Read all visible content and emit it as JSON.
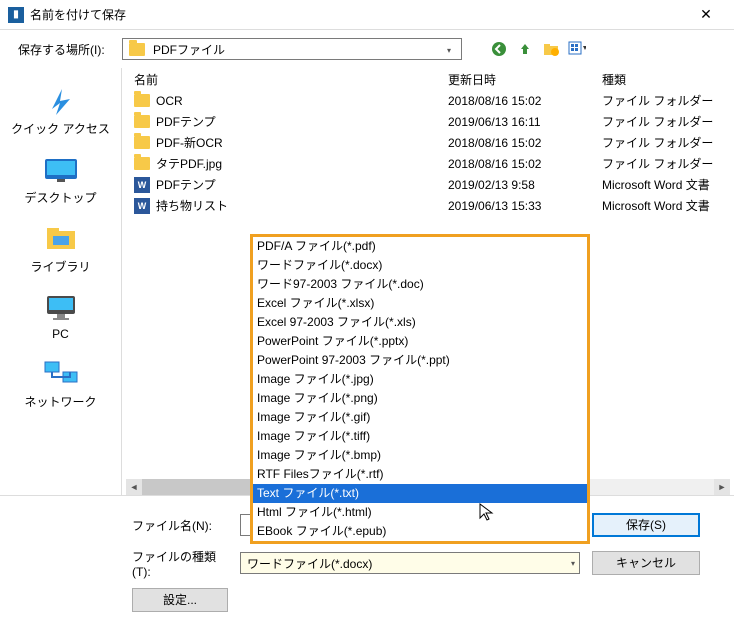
{
  "title": "名前を付けて保存",
  "locationLabel": "保存する場所(I):",
  "locationValue": "PDFファイル",
  "columns": {
    "name": "名前",
    "date": "更新日時",
    "type": "種類"
  },
  "places": [
    {
      "key": "quick",
      "label": "クイック アクセス"
    },
    {
      "key": "desktop",
      "label": "デスクトップ"
    },
    {
      "key": "library",
      "label": "ライブラリ"
    },
    {
      "key": "pc",
      "label": "PC"
    },
    {
      "key": "network",
      "label": "ネットワーク"
    }
  ],
  "files": [
    {
      "icon": "folder",
      "name": "OCR",
      "date": "2018/08/16 15:02",
      "type": "ファイル フォルダー"
    },
    {
      "icon": "folder",
      "name": "PDFテンプ",
      "date": "2019/06/13 16:11",
      "type": "ファイル フォルダー"
    },
    {
      "icon": "folder",
      "name": "PDF-新OCR",
      "date": "2018/08/16 15:02",
      "type": "ファイル フォルダー"
    },
    {
      "icon": "folder",
      "name": "タテPDF.jpg",
      "date": "2018/08/16 15:02",
      "type": "ファイル フォルダー"
    },
    {
      "icon": "doc",
      "name": "PDFテンプ",
      "date": "2019/02/13 9:58",
      "type": "Microsoft Word 文書"
    },
    {
      "icon": "doc",
      "name": "持ち物リスト",
      "date": "2019/06/13 15:33",
      "type": "Microsoft Word 文書"
    }
  ],
  "filenameLabel": "ファイル名(N):",
  "filetypeLabel": "ファイルの種類(T):",
  "filetypeValue": "ワードファイル(*.docx)",
  "saveBtn": "保存(S)",
  "cancelBtn": "キャンセル",
  "settingsBtn": "設定...",
  "typeOptions": [
    "PDF/A ファイル(*.pdf)",
    "ワードファイル(*.docx)",
    "ワード97-2003 ファイル(*.doc)",
    "Excel ファイル(*.xlsx)",
    "Excel 97-2003 ファイル(*.xls)",
    "PowerPoint ファイル(*.pptx)",
    "PowerPoint 97-2003 ファイル(*.ppt)",
    "Image ファイル(*.jpg)",
    "Image ファイル(*.png)",
    "Image ファイル(*.gif)",
    "Image ファイル(*.tiff)",
    "Image ファイル(*.bmp)",
    "RTF Filesファイル(*.rtf)",
    "Text ファイル(*.txt)",
    "Html ファイル(*.html)",
    "EBook ファイル(*.epub)"
  ],
  "selectedTypeIndex": 13,
  "toolbarIcons": [
    "back-icon",
    "up-icon",
    "newfolder-icon",
    "viewmenu-icon"
  ],
  "colors": {
    "highlight": "#1a6fd8",
    "dropdownBorder": "#f0a020"
  }
}
